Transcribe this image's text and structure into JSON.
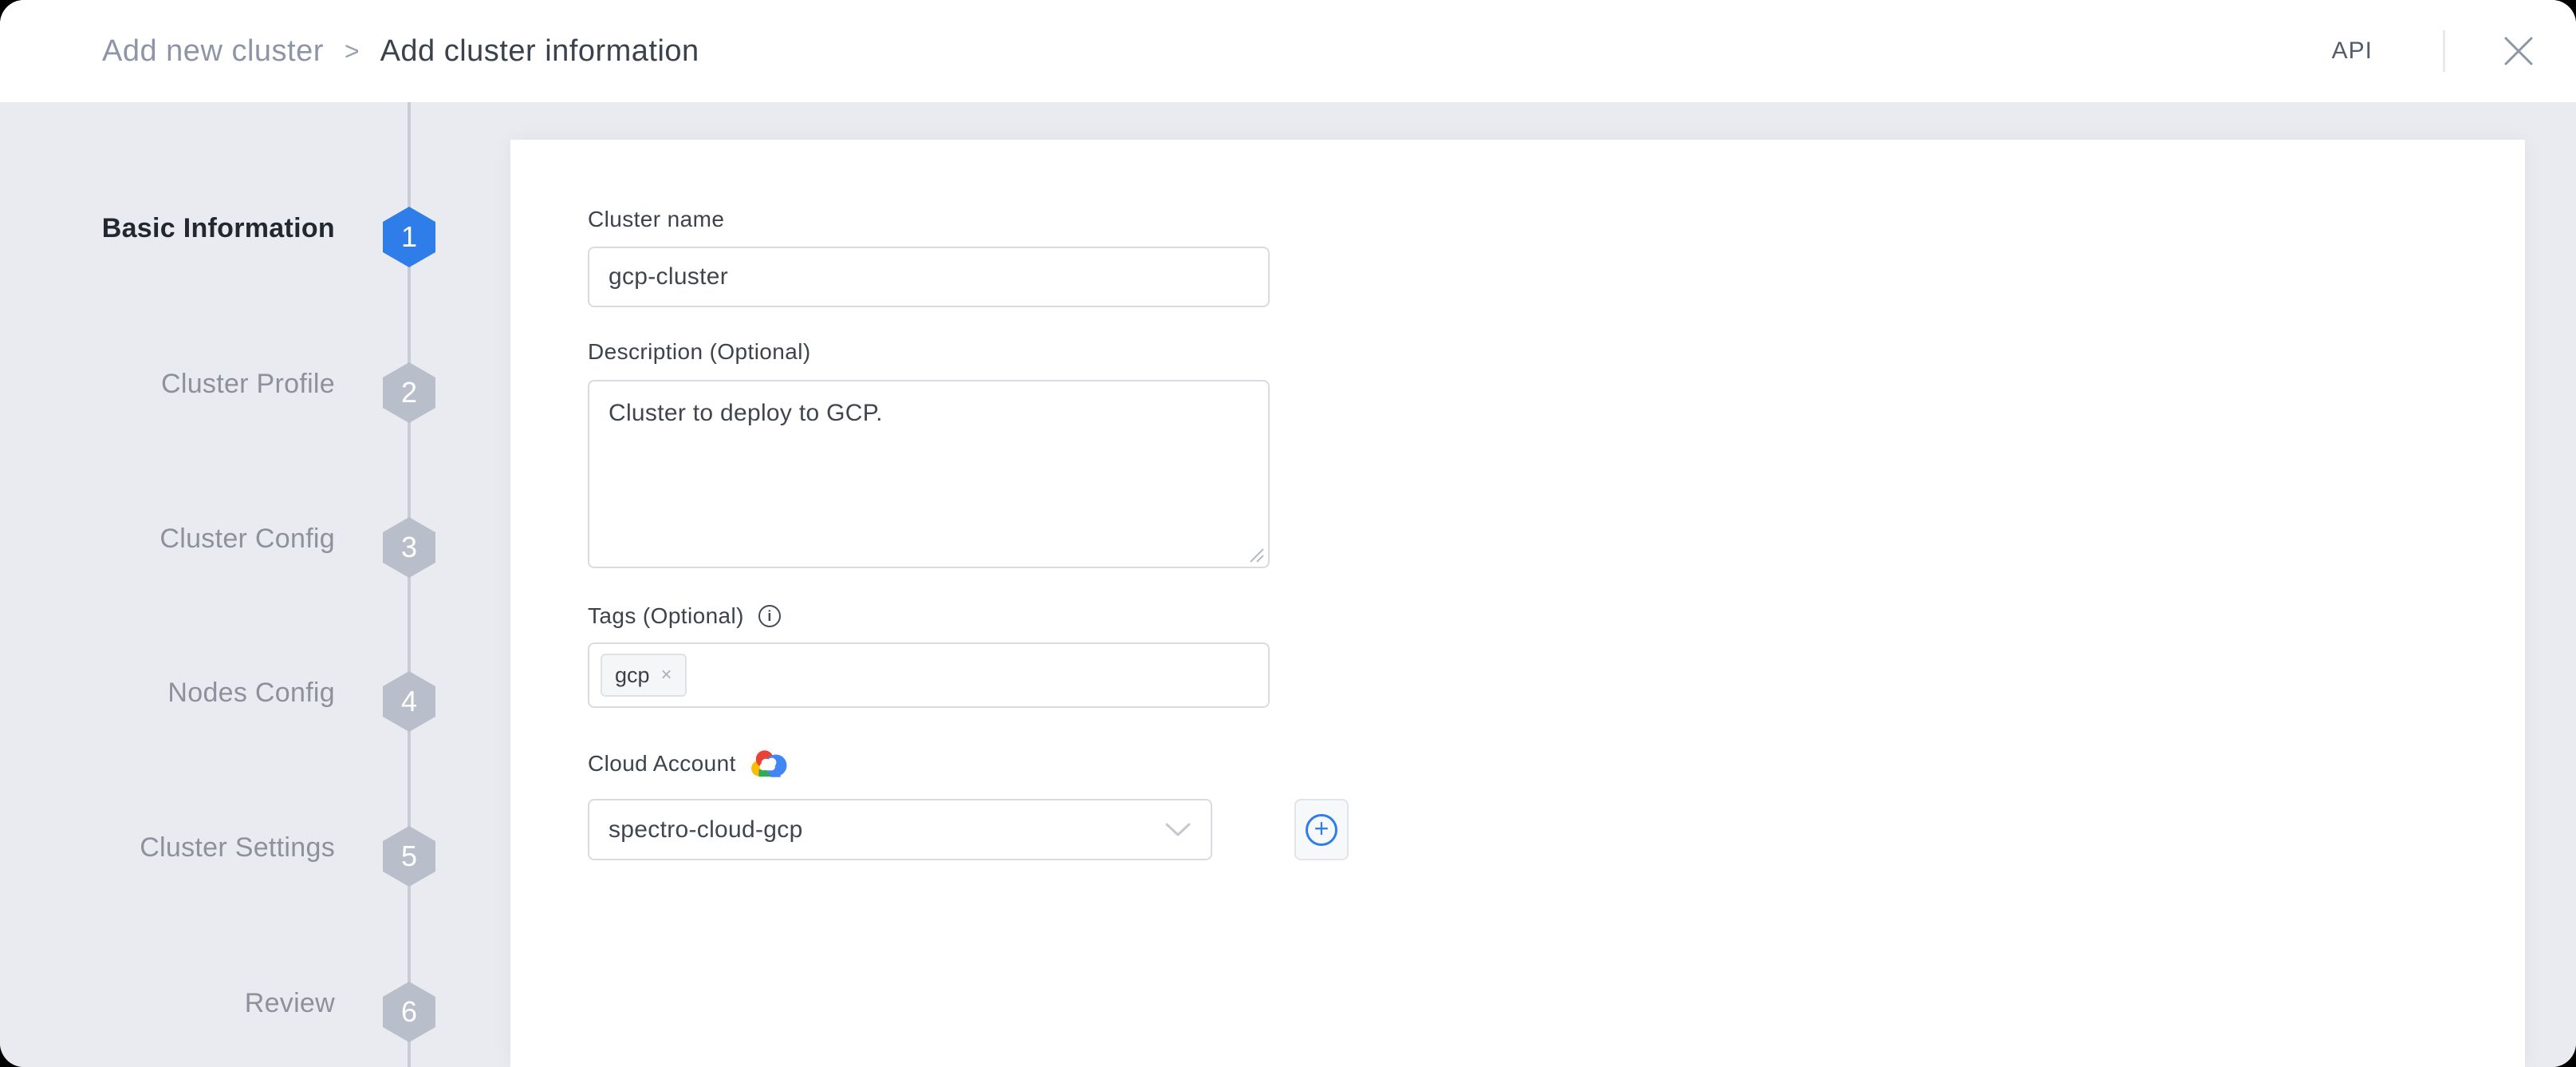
{
  "header": {
    "breadcrumb": {
      "parent": "Add new cluster",
      "separator": ">",
      "current": "Add cluster information"
    },
    "api_label": "API"
  },
  "steps": [
    {
      "number": "1",
      "label": "Basic Information",
      "state": "active"
    },
    {
      "number": "2",
      "label": "Cluster Profile",
      "state": "upcoming"
    },
    {
      "number": "3",
      "label": "Cluster Config",
      "state": "upcoming"
    },
    {
      "number": "4",
      "label": "Nodes Config",
      "state": "upcoming"
    },
    {
      "number": "5",
      "label": "Cluster Settings",
      "state": "upcoming"
    },
    {
      "number": "6",
      "label": "Review",
      "state": "upcoming"
    }
  ],
  "form": {
    "cluster_name": {
      "label": "Cluster name",
      "value": "gcp-cluster"
    },
    "description": {
      "label": "Description (Optional)",
      "value": "Cluster to deploy to GCP."
    },
    "tags": {
      "label": "Tags (Optional)",
      "info_icon": "i",
      "chips": [
        {
          "text": "gcp",
          "remove_icon": "×"
        }
      ]
    },
    "cloud_account": {
      "label": "Cloud Account",
      "provider_icon": "google-cloud",
      "selected_value": "spectro-cloud-gcp",
      "add_button_icon": "+"
    }
  },
  "colors": {
    "accent_blue": "#2e7de9",
    "step_inactive_gray": "#b8bfca",
    "sidebar_bg": "#eaebf0",
    "gcp_red": "#ea4335",
    "gcp_blue": "#4285f4",
    "gcp_green": "#34a853",
    "gcp_yellow": "#fbbc05"
  }
}
